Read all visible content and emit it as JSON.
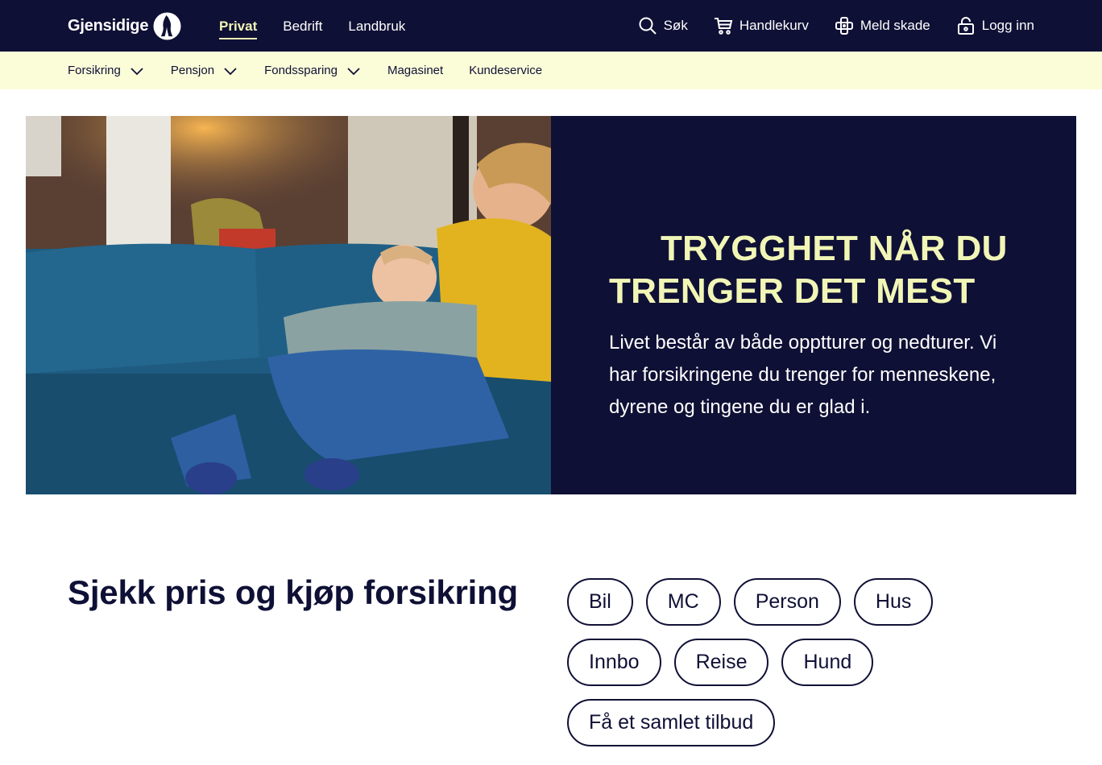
{
  "brand": {
    "name": "Gjensidige"
  },
  "segments": [
    {
      "label": "Privat",
      "active": true
    },
    {
      "label": "Bedrift",
      "active": false
    },
    {
      "label": "Landbruk",
      "active": false
    }
  ],
  "tools": [
    {
      "label": "Søk",
      "icon": "search-icon"
    },
    {
      "label": "Handlekurv",
      "icon": "cart-icon"
    },
    {
      "label": "Meld skade",
      "icon": "bandage-icon"
    },
    {
      "label": "Logg inn",
      "icon": "lock-icon"
    }
  ],
  "subnav": [
    {
      "label": "Forsikring",
      "dropdown": true
    },
    {
      "label": "Pensjon",
      "dropdown": true
    },
    {
      "label": "Fondssparing",
      "dropdown": true
    },
    {
      "label": "Magasinet",
      "dropdown": false
    },
    {
      "label": "Kundeservice",
      "dropdown": false
    }
  ],
  "hero": {
    "title_line1": "TRYGGHET NÅR DU",
    "title_line2": "TRENGER DET MEST",
    "text": "Livet består av både opptturer og nedturer. Vi har forsikringene du trenger for menneskene, dyrene og tingene du er glad i."
  },
  "quote": {
    "title": "Sjekk pris og kjøp forsikring",
    "chips": [
      [
        "Bil",
        "MC",
        "Person",
        "Hus"
      ],
      [
        "Innbo",
        "Reise",
        "Hund"
      ],
      [
        "Få et samlet tilbud"
      ]
    ]
  },
  "colors": {
    "navy": "#0f1035",
    "yellow": "#f1f6b6",
    "subnav_bg": "#fbfdd9"
  }
}
